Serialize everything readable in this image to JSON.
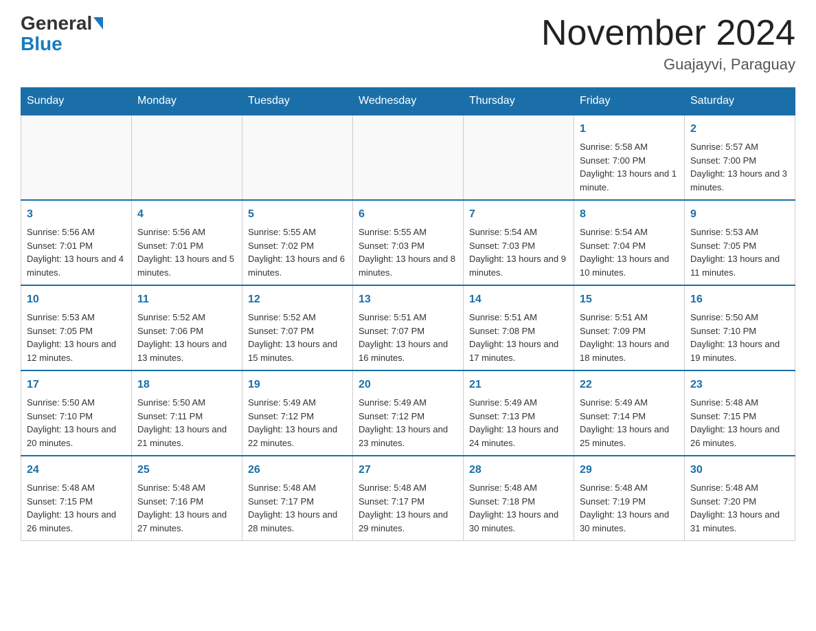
{
  "header": {
    "logo": {
      "name_black": "General",
      "name_blue": "Blue"
    },
    "title": "November 2024",
    "subtitle": "Guajayvi, Paraguay"
  },
  "weekdays": [
    "Sunday",
    "Monday",
    "Tuesday",
    "Wednesday",
    "Thursday",
    "Friday",
    "Saturday"
  ],
  "weeks": [
    [
      {
        "day": "",
        "sunrise": "",
        "sunset": "",
        "daylight": ""
      },
      {
        "day": "",
        "sunrise": "",
        "sunset": "",
        "daylight": ""
      },
      {
        "day": "",
        "sunrise": "",
        "sunset": "",
        "daylight": ""
      },
      {
        "day": "",
        "sunrise": "",
        "sunset": "",
        "daylight": ""
      },
      {
        "day": "",
        "sunrise": "",
        "sunset": "",
        "daylight": ""
      },
      {
        "day": "1",
        "sunrise": "Sunrise: 5:58 AM",
        "sunset": "Sunset: 7:00 PM",
        "daylight": "Daylight: 13 hours and 1 minute."
      },
      {
        "day": "2",
        "sunrise": "Sunrise: 5:57 AM",
        "sunset": "Sunset: 7:00 PM",
        "daylight": "Daylight: 13 hours and 3 minutes."
      }
    ],
    [
      {
        "day": "3",
        "sunrise": "Sunrise: 5:56 AM",
        "sunset": "Sunset: 7:01 PM",
        "daylight": "Daylight: 13 hours and 4 minutes."
      },
      {
        "day": "4",
        "sunrise": "Sunrise: 5:56 AM",
        "sunset": "Sunset: 7:01 PM",
        "daylight": "Daylight: 13 hours and 5 minutes."
      },
      {
        "day": "5",
        "sunrise": "Sunrise: 5:55 AM",
        "sunset": "Sunset: 7:02 PM",
        "daylight": "Daylight: 13 hours and 6 minutes."
      },
      {
        "day": "6",
        "sunrise": "Sunrise: 5:55 AM",
        "sunset": "Sunset: 7:03 PM",
        "daylight": "Daylight: 13 hours and 8 minutes."
      },
      {
        "day": "7",
        "sunrise": "Sunrise: 5:54 AM",
        "sunset": "Sunset: 7:03 PM",
        "daylight": "Daylight: 13 hours and 9 minutes."
      },
      {
        "day": "8",
        "sunrise": "Sunrise: 5:54 AM",
        "sunset": "Sunset: 7:04 PM",
        "daylight": "Daylight: 13 hours and 10 minutes."
      },
      {
        "day": "9",
        "sunrise": "Sunrise: 5:53 AM",
        "sunset": "Sunset: 7:05 PM",
        "daylight": "Daylight: 13 hours and 11 minutes."
      }
    ],
    [
      {
        "day": "10",
        "sunrise": "Sunrise: 5:53 AM",
        "sunset": "Sunset: 7:05 PM",
        "daylight": "Daylight: 13 hours and 12 minutes."
      },
      {
        "day": "11",
        "sunrise": "Sunrise: 5:52 AM",
        "sunset": "Sunset: 7:06 PM",
        "daylight": "Daylight: 13 hours and 13 minutes."
      },
      {
        "day": "12",
        "sunrise": "Sunrise: 5:52 AM",
        "sunset": "Sunset: 7:07 PM",
        "daylight": "Daylight: 13 hours and 15 minutes."
      },
      {
        "day": "13",
        "sunrise": "Sunrise: 5:51 AM",
        "sunset": "Sunset: 7:07 PM",
        "daylight": "Daylight: 13 hours and 16 minutes."
      },
      {
        "day": "14",
        "sunrise": "Sunrise: 5:51 AM",
        "sunset": "Sunset: 7:08 PM",
        "daylight": "Daylight: 13 hours and 17 minutes."
      },
      {
        "day": "15",
        "sunrise": "Sunrise: 5:51 AM",
        "sunset": "Sunset: 7:09 PM",
        "daylight": "Daylight: 13 hours and 18 minutes."
      },
      {
        "day": "16",
        "sunrise": "Sunrise: 5:50 AM",
        "sunset": "Sunset: 7:10 PM",
        "daylight": "Daylight: 13 hours and 19 minutes."
      }
    ],
    [
      {
        "day": "17",
        "sunrise": "Sunrise: 5:50 AM",
        "sunset": "Sunset: 7:10 PM",
        "daylight": "Daylight: 13 hours and 20 minutes."
      },
      {
        "day": "18",
        "sunrise": "Sunrise: 5:50 AM",
        "sunset": "Sunset: 7:11 PM",
        "daylight": "Daylight: 13 hours and 21 minutes."
      },
      {
        "day": "19",
        "sunrise": "Sunrise: 5:49 AM",
        "sunset": "Sunset: 7:12 PM",
        "daylight": "Daylight: 13 hours and 22 minutes."
      },
      {
        "day": "20",
        "sunrise": "Sunrise: 5:49 AM",
        "sunset": "Sunset: 7:12 PM",
        "daylight": "Daylight: 13 hours and 23 minutes."
      },
      {
        "day": "21",
        "sunrise": "Sunrise: 5:49 AM",
        "sunset": "Sunset: 7:13 PM",
        "daylight": "Daylight: 13 hours and 24 minutes."
      },
      {
        "day": "22",
        "sunrise": "Sunrise: 5:49 AM",
        "sunset": "Sunset: 7:14 PM",
        "daylight": "Daylight: 13 hours and 25 minutes."
      },
      {
        "day": "23",
        "sunrise": "Sunrise: 5:48 AM",
        "sunset": "Sunset: 7:15 PM",
        "daylight": "Daylight: 13 hours and 26 minutes."
      }
    ],
    [
      {
        "day": "24",
        "sunrise": "Sunrise: 5:48 AM",
        "sunset": "Sunset: 7:15 PM",
        "daylight": "Daylight: 13 hours and 26 minutes."
      },
      {
        "day": "25",
        "sunrise": "Sunrise: 5:48 AM",
        "sunset": "Sunset: 7:16 PM",
        "daylight": "Daylight: 13 hours and 27 minutes."
      },
      {
        "day": "26",
        "sunrise": "Sunrise: 5:48 AM",
        "sunset": "Sunset: 7:17 PM",
        "daylight": "Daylight: 13 hours and 28 minutes."
      },
      {
        "day": "27",
        "sunrise": "Sunrise: 5:48 AM",
        "sunset": "Sunset: 7:17 PM",
        "daylight": "Daylight: 13 hours and 29 minutes."
      },
      {
        "day": "28",
        "sunrise": "Sunrise: 5:48 AM",
        "sunset": "Sunset: 7:18 PM",
        "daylight": "Daylight: 13 hours and 30 minutes."
      },
      {
        "day": "29",
        "sunrise": "Sunrise: 5:48 AM",
        "sunset": "Sunset: 7:19 PM",
        "daylight": "Daylight: 13 hours and 30 minutes."
      },
      {
        "day": "30",
        "sunrise": "Sunrise: 5:48 AM",
        "sunset": "Sunset: 7:20 PM",
        "daylight": "Daylight: 13 hours and 31 minutes."
      }
    ]
  ]
}
